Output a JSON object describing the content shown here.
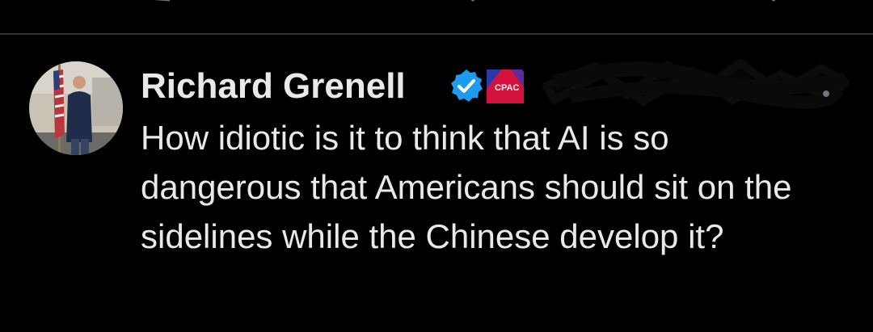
{
  "top_actions": [
    {
      "icon": "reply-icon"
    },
    {
      "icon": "retweet-icon"
    },
    {
      "icon": "like-icon"
    },
    {
      "icon": "views-icon"
    },
    {
      "icon": "bookmark-icon"
    },
    {
      "icon": "share-icon"
    }
  ],
  "tweet": {
    "author": {
      "display_name": "Richard Grenell",
      "verified": true,
      "verified_color": "#1d9bf0",
      "affiliate_badge": "CPAC",
      "handle_redacted": true
    },
    "text": "How idiotic is it to think that AI is so dangerous that Americans should sit on the sidelines while the Chinese develop it?"
  },
  "colors": {
    "background": "#000000",
    "text": "#e7e9ea",
    "secondary_text": "#71767b",
    "divider": "#2f3336"
  }
}
